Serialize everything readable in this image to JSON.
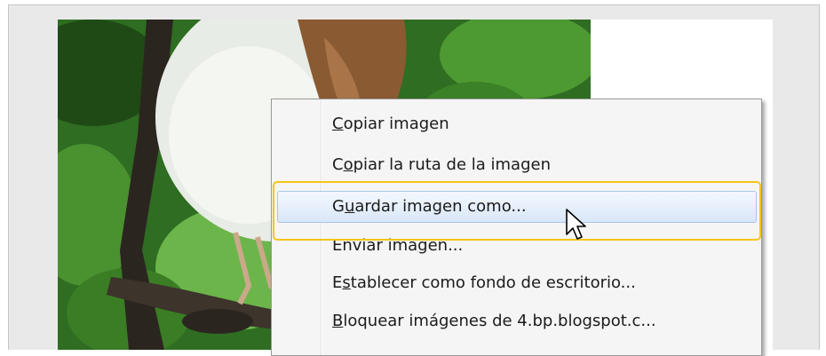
{
  "context_menu": {
    "items": [
      {
        "pre": "",
        "ul": "C",
        "post": "opiar imagen"
      },
      {
        "pre": "C",
        "ul": "o",
        "post": "piar la ruta de la imagen"
      },
      {
        "pre": "G",
        "ul": "u",
        "post": "ardar imagen como..."
      },
      {
        "pre": "Enviar ima",
        "ul": "g",
        "post": "en..."
      },
      {
        "pre": "E",
        "ul": "s",
        "post": "tablecer como fondo de escritorio..."
      },
      {
        "pre": "",
        "ul": "B",
        "post": "loquear imágenes de 4.bp.blogspot.c..."
      }
    ],
    "highlighted_index": 2
  },
  "icons": {
    "cursor": "mouse-pointer-icon"
  },
  "colors": {
    "highlight_border": "#a8c6ea",
    "focus_ring": "#f5c518",
    "menu_bg": "#f5f5f5",
    "window_bg": "#e9e9e9"
  }
}
